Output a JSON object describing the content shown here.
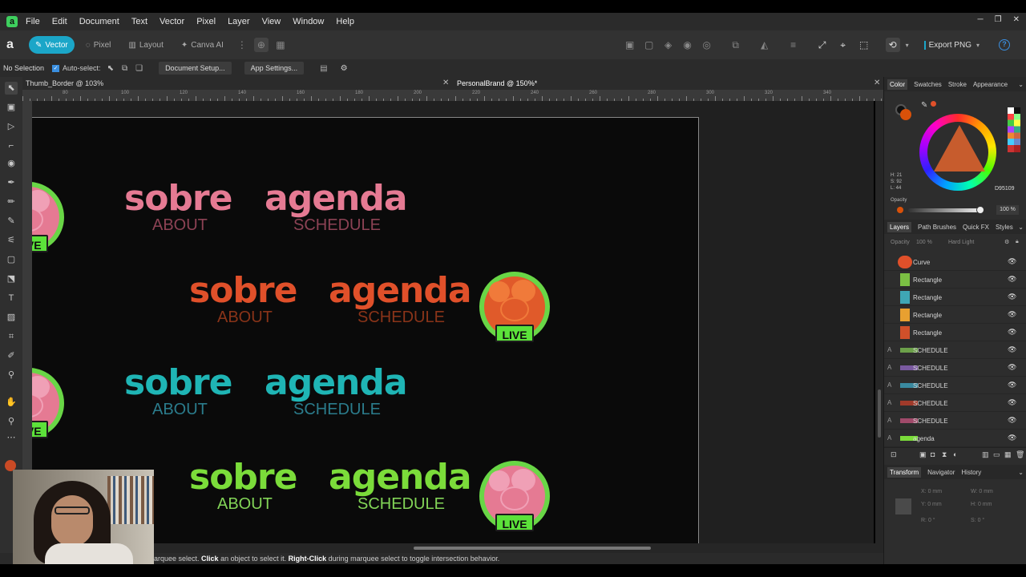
{
  "menubar": {
    "app_logo": "a",
    "items": [
      "File",
      "Edit",
      "Document",
      "Text",
      "Vector",
      "Pixel",
      "Layer",
      "View",
      "Window",
      "Help"
    ]
  },
  "toolbar": {
    "personas": [
      "Vector",
      "Pixel",
      "Layout",
      "Canva AI"
    ],
    "export_label": "Export PNG"
  },
  "context": {
    "selection": "No Selection",
    "autoselect": "Auto-select:",
    "document_setup": "Document Setup...",
    "app_settings": "App Settings..."
  },
  "tabs": [
    "Thumb_Border @ 103%",
    "PersonalBrand @ 150%*"
  ],
  "ruler_ticks": [
    "80",
    "100",
    "120",
    "140",
    "160",
    "180",
    "200",
    "220",
    "240",
    "260",
    "280",
    "300",
    "320",
    "340"
  ],
  "canvas": {
    "rows": [
      {
        "word1": "sobre",
        "sub1": "ABOUT",
        "word2": "agenda",
        "sub2": "SCHEDULE",
        "color": "#e57a93",
        "subcolor": "#8c4254",
        "live": "LIVE"
      },
      {
        "word1": "sobre",
        "sub1": "ABOUT",
        "word2": "agenda",
        "sub2": "SCHEDULE",
        "color": "#e0502a",
        "subcolor": "#8a3419",
        "live": "LIVE"
      },
      {
        "word1": "sobre",
        "sub1": "ABOUT",
        "word2": "agenda",
        "sub2": "SCHEDULE",
        "color": "#1fb5b5",
        "subcolor": "#2b7c8c",
        "live": "LIVE"
      },
      {
        "word1": "sobre",
        "sub1": "ABOUT",
        "word2": "agenda",
        "sub2": "SCHEDULE",
        "color": "#7bdc3a",
        "subcolor": "#82d457",
        "live": "LIVE"
      }
    ]
  },
  "status_bar": {
    "text_a": "arquee select. ",
    "bold_a": "Click",
    "text_b": " an object to select it. ",
    "bold_b": "Right-Click",
    "text_c": " during marquee select to toggle intersection behavior."
  },
  "color_panel": {
    "tabs": [
      "Color",
      "Swatches",
      "Stroke",
      "Appearance"
    ],
    "h": "H: 21",
    "s": "S: 92",
    "l": "L: 44",
    "hex": "D95109",
    "opacity_label": "Opacity",
    "opacity_value": "100 %",
    "current_color": "#d95109"
  },
  "layers_panel": {
    "tabs": [
      "Layers",
      "Path Brushes",
      "Quick FX",
      "Styles"
    ],
    "opacity": "100 %",
    "opacity_label": "Opacity",
    "blend_mode": "Hard Light",
    "layers": [
      {
        "name": "Curve",
        "kind": "",
        "color": "#e0502a"
      },
      {
        "name": "Rectangle",
        "kind": "",
        "color": "#7bc043"
      },
      {
        "name": "Rectangle",
        "kind": "",
        "color": "#3fa7b5"
      },
      {
        "name": "Rectangle",
        "kind": "",
        "color": "#e8a030"
      },
      {
        "name": "Rectangle",
        "kind": "",
        "color": "#d0502a"
      },
      {
        "name": "SCHEDULE",
        "kind": "A",
        "color": "#6ca04a"
      },
      {
        "name": "SCHEDULE",
        "kind": "A",
        "color": "#7a5aa0"
      },
      {
        "name": "SCHEDULE",
        "kind": "A",
        "color": "#3a8aa0"
      },
      {
        "name": "SCHEDULE",
        "kind": "A",
        "color": "#a03a2a"
      },
      {
        "name": "SCHEDULE",
        "kind": "A",
        "color": "#a04a6a"
      },
      {
        "name": "agenda",
        "kind": "A",
        "color": "#7bdc3a"
      }
    ]
  },
  "transform_panel": {
    "tabs": [
      "Transform",
      "Navigator",
      "History"
    ],
    "x": "0 mm",
    "y": "0 mm",
    "w": "0 mm",
    "h": "0 mm",
    "r": "0 °",
    "s": "0 °"
  }
}
